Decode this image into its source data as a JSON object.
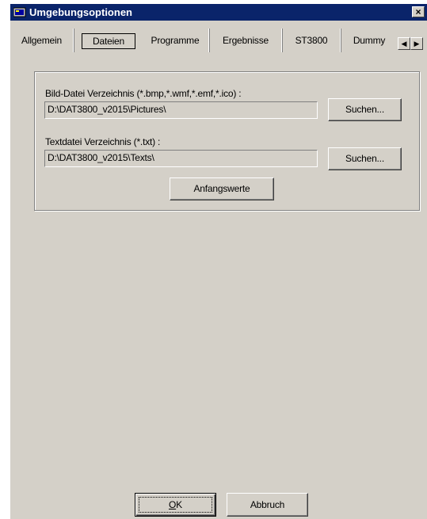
{
  "window": {
    "title": "Umgebungsoptionen",
    "close_label": "×"
  },
  "tabs": [
    {
      "label": "Allgemein"
    },
    {
      "label": "Dateien"
    },
    {
      "label": "Programme"
    },
    {
      "label": "Ergebnisse"
    },
    {
      "label": "ST3800"
    },
    {
      "label": "Dummy"
    }
  ],
  "tab_scroll": {
    "left": "◀",
    "right": "▶"
  },
  "dateien": {
    "bild_label": "Bild-Datei Verzeichnis (*.bmp,*.wmf,*.emf,*.ico) :",
    "bild_path": "D:\\DAT3800_v2015\\Pictures\\",
    "text_label": "Textdatei Verzeichnis (*.txt) :",
    "text_path": "D:\\DAT3800_v2015\\Texts\\",
    "suchen_label": "Suchen...",
    "defaults_label": "Anfangswerte"
  },
  "footer": {
    "ok_accel": "O",
    "ok_rest": "K",
    "cancel_label": "Abbruch"
  },
  "colors": {
    "titlebar": "#0a246a",
    "face": "#d4d0c8"
  }
}
